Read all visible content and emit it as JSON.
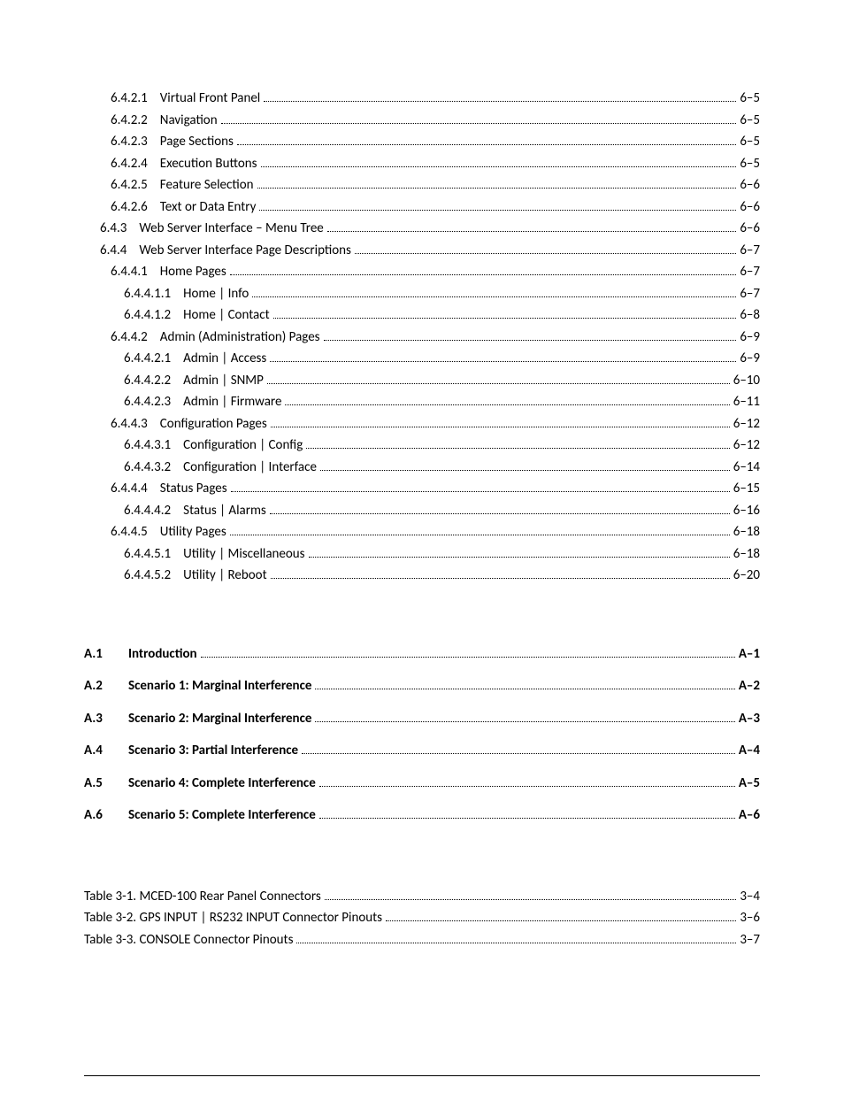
{
  "toc": [
    {
      "indent": 1,
      "num": "6.4.2.1",
      "title": "Virtual Front Panel",
      "page": "6–5"
    },
    {
      "indent": 1,
      "num": "6.4.2.2",
      "title": "Navigation",
      "page": "6–5"
    },
    {
      "indent": 1,
      "num": "6.4.2.3",
      "title": "Page Sections",
      "page": "6–5"
    },
    {
      "indent": 1,
      "num": "6.4.2.4",
      "title": "Execution Buttons",
      "page": "6–5"
    },
    {
      "indent": 1,
      "num": "6.4.2.5",
      "title": "Feature Selection",
      "page": "6–6"
    },
    {
      "indent": 1,
      "num": "6.4.2.6",
      "title": "Text or Data Entry",
      "page": "6–6"
    },
    {
      "indent": 2,
      "num": "6.4.3",
      "title": "Web Server Interface – Menu Tree",
      "page": "6–6"
    },
    {
      "indent": 2,
      "num": "6.4.4",
      "title": "Web Server Interface Page Descriptions",
      "page": "6–7"
    },
    {
      "indent": 3,
      "num": "6.4.4.1",
      "title": "Home Pages",
      "page": "6–7"
    },
    {
      "indent": 4,
      "num": "6.4.4.1.1",
      "title": "Home | Info",
      "page": "6–7"
    },
    {
      "indent": 4,
      "num": "6.4.4.1.2",
      "title": "Home | Contact",
      "page": "6–8"
    },
    {
      "indent": 3,
      "num": "6.4.4.2",
      "title": "Admin (Administration) Pages",
      "page": "6–9"
    },
    {
      "indent": 4,
      "num": "6.4.4.2.1",
      "title": "Admin | Access",
      "page": "6–9"
    },
    {
      "indent": 4,
      "num": "6.4.4.2.2",
      "title": "Admin | SNMP",
      "page": "6–10"
    },
    {
      "indent": 4,
      "num": "6.4.4.2.3",
      "title": "Admin | Firmware",
      "page": "6–11"
    },
    {
      "indent": 3,
      "num": "6.4.4.3",
      "title": "Configuration Pages",
      "page": "6–12"
    },
    {
      "indent": 4,
      "num": "6.4.4.3.1",
      "title": "Configuration | Config",
      "page": "6–12"
    },
    {
      "indent": 4,
      "num": "6.4.4.3.2",
      "title": "Configuration | Interface",
      "page": "6–14"
    },
    {
      "indent": 3,
      "num": "6.4.4.4",
      "title": "Status Pages",
      "page": "6–15"
    },
    {
      "indent": 4,
      "num": "6.4.4.4.2",
      "title": "Status | Alarms",
      "page": "6–16"
    },
    {
      "indent": 3,
      "num": "6.4.4.5",
      "title": "Utility Pages",
      "page": "6–18"
    },
    {
      "indent": 4,
      "num": "6.4.4.5.1",
      "title": "Utility | Miscellaneous",
      "page": "6–18"
    },
    {
      "indent": 4,
      "num": "6.4.4.5.2",
      "title": "Utility | Reboot",
      "page": "6–20"
    }
  ],
  "appendix": [
    {
      "num": "A.1",
      "title": "Introduction",
      "page": "A–1"
    },
    {
      "num": "A.2",
      "title": "Scenario 1: Marginal Interference",
      "page": "A–2"
    },
    {
      "num": "A.3",
      "title": "Scenario 2: Marginal Interference",
      "page": "A–3"
    },
    {
      "num": "A.4",
      "title": "Scenario 3: Partial Interference",
      "page": "A–4"
    },
    {
      "num": "A.5",
      "title": "Scenario 4: Complete Interference",
      "page": "A–5"
    },
    {
      "num": "A.6",
      "title": "Scenario 5: Complete Interference",
      "page": "A–6"
    }
  ],
  "tables": [
    {
      "title": "Table 3-1. MCED-100 Rear Panel Connectors",
      "page": "3–4"
    },
    {
      "title": "Table 3-2.  GPS INPUT | RS232 INPUT Connector Pinouts",
      "page": "3–6"
    },
    {
      "title": "Table 3-3.  CONSOLE Connector Pinouts",
      "page": "3–7"
    }
  ]
}
